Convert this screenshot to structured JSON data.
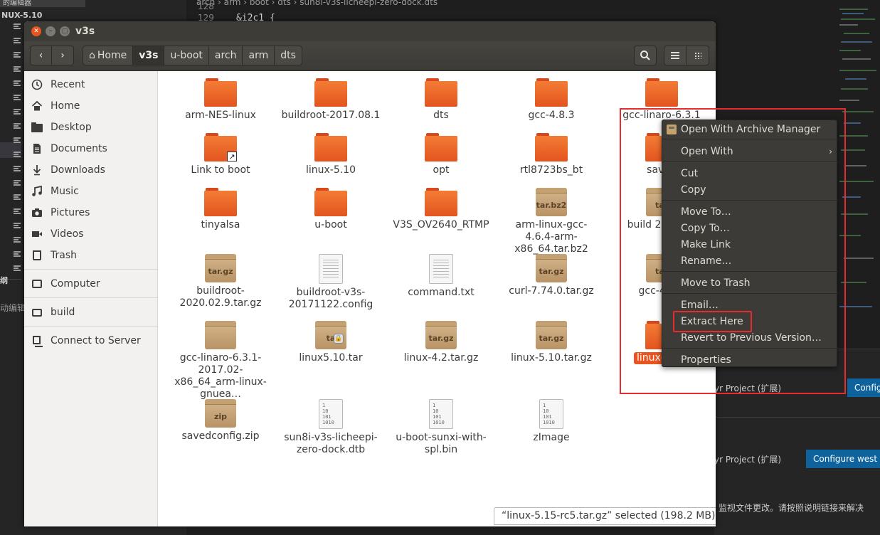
{
  "background": {
    "explorer_tab": "的编辑器",
    "explorer_root": "NUX-5.10",
    "outline_label": "纲",
    "hint_text": "动编辑",
    "breadcrumb": "arch  ›  arm  ›  boot  ›  dts  ›  sun8i-v3s-licheepi-zero-dock.dts",
    "line_numbers": [
      "128",
      "129"
    ],
    "code_line": "&i2c1 {",
    "ext_row1": "yr Project (扩展)",
    "ext_btn1": "Configure west p",
    "ext_row2": "yr Project (扩展)",
    "ext_btn2": "Configure west p",
    "notification": "监视文件更改。请按照说明链接来解决"
  },
  "window": {
    "title": "v3s",
    "back_label": "‹",
    "forward_label": "›",
    "path": [
      "Home",
      "v3s",
      "u-boot",
      "arch",
      "arm",
      "dts"
    ]
  },
  "sidebar": {
    "items": [
      {
        "label": "Recent",
        "icon": "clock-icon"
      },
      {
        "label": "Home",
        "icon": "home-icon"
      },
      {
        "label": "Desktop",
        "icon": "folder-icon"
      },
      {
        "label": "Documents",
        "icon": "document-icon"
      },
      {
        "label": "Downloads",
        "icon": "download-icon"
      },
      {
        "label": "Music",
        "icon": "music-icon"
      },
      {
        "label": "Pictures",
        "icon": "camera-icon"
      },
      {
        "label": "Videos",
        "icon": "video-icon"
      },
      {
        "label": "Trash",
        "icon": "trash-icon"
      },
      {
        "label": "Computer",
        "icon": "computer-icon"
      },
      {
        "label": "build",
        "icon": "drive-icon"
      },
      {
        "label": "Connect to Server",
        "icon": "server-icon"
      }
    ]
  },
  "files": [
    {
      "label": "arm-NES-linux",
      "type": "folder"
    },
    {
      "label": "buildroot-2017.08.1",
      "type": "folder"
    },
    {
      "label": "dts",
      "type": "folder"
    },
    {
      "label": "gcc-4.8.3",
      "type": "folder"
    },
    {
      "label": "gcc-linaro-6.3.1",
      "type": "folder"
    },
    {
      "label": "Link to boot",
      "type": "folder-link"
    },
    {
      "label": "linux-5.10",
      "type": "folder"
    },
    {
      "label": "opt",
      "type": "folder"
    },
    {
      "label": "rtl8723bs_bt",
      "type": "folder"
    },
    {
      "label": "saved",
      "type": "folder"
    },
    {
      "label": "tinyalsa",
      "type": "folder"
    },
    {
      "label": "u-boot",
      "type": "folder"
    },
    {
      "label": "V3S_OV2640_RTMP",
      "type": "folder"
    },
    {
      "label": "arm-linux-gcc-4.6.4-arm-x86_64.tar.bz2",
      "type": "archive",
      "ext": "tar.bz2"
    },
    {
      "label": "build 2017.08",
      "type": "archive",
      "ext": "tar"
    },
    {
      "label": "buildroot-2020.02.9.tar.gz",
      "type": "archive",
      "ext": "tar.gz"
    },
    {
      "label": "buildroot-v3s-20171122.config",
      "type": "text"
    },
    {
      "label": "command.txt",
      "type": "text"
    },
    {
      "label": "curl-7.74.0.tar.gz",
      "type": "archive",
      "ext": "tar.gz"
    },
    {
      "label": "gcc-4.8.3",
      "type": "archive",
      "ext": "tar"
    },
    {
      "label": "gcc-linaro-6.3.1-2017.02-x86_64_arm-linux-gnuea…",
      "type": "archive",
      "ext": ""
    },
    {
      "label": "linux5.10.tar",
      "type": "archive-locked",
      "ext": "ta"
    },
    {
      "label": "linux-4.2.tar.gz",
      "type": "archive",
      "ext": "tar.gz"
    },
    {
      "label": "linux-5.10.tar.gz",
      "type": "archive",
      "ext": "tar.gz"
    },
    {
      "label": "linux-5.15",
      "type": "archive-selected",
      "ext": ""
    },
    {
      "label": "savedconfig.zip",
      "type": "archive",
      "ext": "zip"
    },
    {
      "label": "sun8i-v3s-licheepi-zero-dock.dtb",
      "type": "binary"
    },
    {
      "label": "u-boot-sunxi-with-spl.bin",
      "type": "binary"
    },
    {
      "label": "zImage",
      "type": "binary"
    }
  ],
  "binary_glyph": "1\n10\n101\n1010",
  "status": "“linux-5.15-rc5.tar.gz” selected  (198.2 MB)",
  "context_menu": {
    "items": [
      {
        "label": "Open With Archive Manager",
        "mnemonic": "O"
      },
      {
        "label": "Open With",
        "submenu": true
      },
      {
        "label": "Cut"
      },
      {
        "label": "Copy"
      },
      {
        "label": "Move To…"
      },
      {
        "label": "Copy To…"
      },
      {
        "label": "Make Link"
      },
      {
        "label": "Rename…"
      },
      {
        "label": "Move to Trash"
      },
      {
        "label": "Email…"
      },
      {
        "label": "Extract Here"
      },
      {
        "label": "Revert to Previous Version…"
      },
      {
        "label": "Properties"
      }
    ]
  },
  "colors": {
    "accent": "#e95420",
    "annotation": "#e62d2d",
    "titlebar": "#3d3c37",
    "menu_bg": "#3c3b37"
  }
}
